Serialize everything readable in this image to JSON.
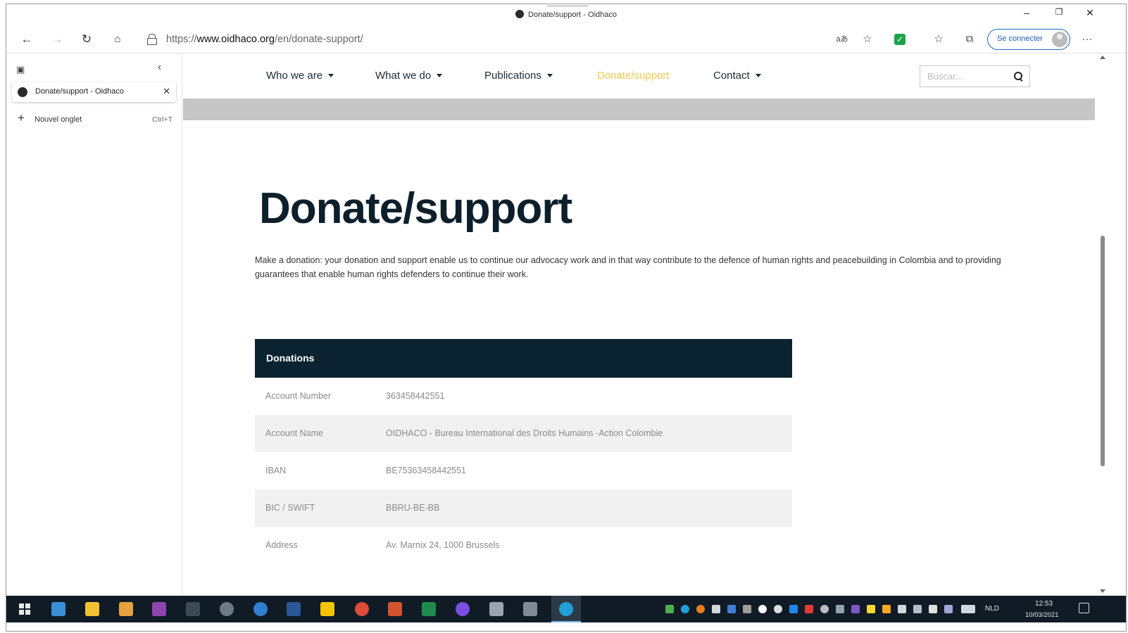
{
  "window": {
    "title": "Donate/support - Oidhaco",
    "controls": [
      "minimize-icon",
      "restore-icon",
      "close-icon"
    ]
  },
  "browser": {
    "url_prefix": "https://",
    "url_domain": "www.oidhaco.org",
    "url_path": "/en/donate-support/",
    "profile_button": "Se connecter",
    "sidebar": {
      "active_tab_title": "Donate/support - Oidhaco",
      "new_tab_label": "Nouvel onglet",
      "new_tab_shortcut": "Ctrl+T"
    }
  },
  "site": {
    "nav": [
      {
        "label": "Who we are",
        "dropdown": true,
        "active": false
      },
      {
        "label": "What we do",
        "dropdown": true,
        "active": false
      },
      {
        "label": "Publications",
        "dropdown": true,
        "active": false
      },
      {
        "label": "Donate/support",
        "dropdown": false,
        "active": true
      },
      {
        "label": "Contact",
        "dropdown": true,
        "active": false
      }
    ],
    "active_color": "#f2c94c",
    "search_placeholder": "Buscar..."
  },
  "main": {
    "heading": "Donate/support",
    "intro": "Make a donation: your donation and support enable us to continue our advocacy work and in that way contribute to the defence of human rights and peacebuilding in Colombia and to providing guarantees that enable human rights defenders to continue their work.",
    "donations": {
      "header": "Donations",
      "rows": [
        {
          "label": "Account Number",
          "value": "363458442551"
        },
        {
          "label": "Account Name",
          "value": "OIDHACO - Bureau International des Droits Humains -Action Colombie"
        },
        {
          "label": "IBAN",
          "value": "BE75363458442551"
        },
        {
          "label": "BIC / SWIFT",
          "value": "BBRU-BE-BB"
        },
        {
          "label": "Address",
          "value": "Av. Marnix 24, 1000 Brussels"
        }
      ]
    }
  },
  "taskbar": {
    "language": "NLD",
    "time": "12:53",
    "date": "10/03/2021"
  }
}
